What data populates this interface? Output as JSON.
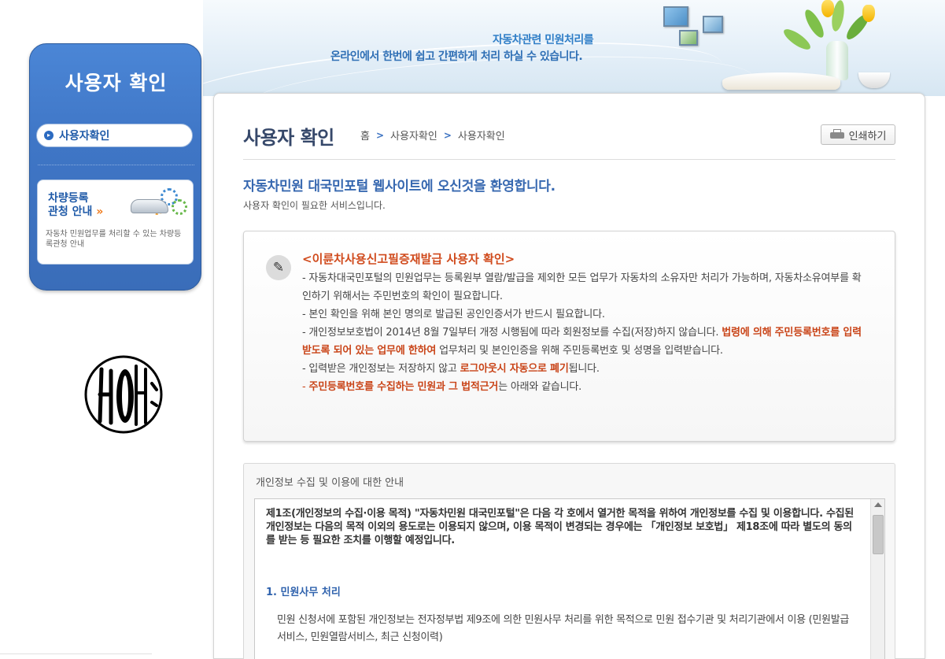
{
  "banner": {
    "line1": "자동차관련 민원처리를",
    "line2": "온라인에서 한번에 쉽고 간편하게 처리 하실 수 있습니다."
  },
  "sidebar": {
    "title": "사용자 확인",
    "items": [
      {
        "label": "사용자확인",
        "icon": "circle-arrow-icon"
      }
    ],
    "promo": {
      "title_line1": "차량등록",
      "title_line2": "관청 안내",
      "arrow": "»",
      "description": "자동차 민원업무를 처리할 수 있는 차량등록관청 안내"
    }
  },
  "header": {
    "page_title": "사용자 확인",
    "breadcrumb": [
      "홈",
      "사용자확인",
      "사용자확인"
    ],
    "breadcrumb_separator": ">",
    "print_label": "인쇄하기"
  },
  "welcome": {
    "title": "자동차민원 대국민포털 웹사이트에 오신것을 환영합니다.",
    "subtitle": "사용자 확인이 필요한 서비스입니다."
  },
  "notice": {
    "heading": "<이륜차사용신고필증재발급 사용자 확인>",
    "p1": "- 자동차대국민포털의 민원업무는 등록원부 열람/발급을 제외한 모든 업무가 자동차의 소유자만 처리가 가능하며, 자동차소유여부를 확인하기 위해서는 주민번호의 확인이 필요합니다.",
    "p2": "- 본인 확인을 위해 본인 명의로 발급된 공인인증서가 반드시 필요합니다.",
    "p3_a": "- 개인정보보호법이 2014년 8월 7일부터 개정 시행됨에 따라 회원정보를 수집(저장)하지 않습니다. ",
    "p3_hl": "법령에 의해 주민등록번호를 입력받도록 되어 있는 업무에 한하여",
    "p3_b": " 업무처리 및 본인인증을 위해 주민등록번호 및 성명을 입력받습니다.",
    "p4_a": "- 입력받은 개인정보는 저장하지 않고 ",
    "p4_hl": "로그아웃시 자동으로 폐기",
    "p4_b": "됩니다.",
    "p5_dash": "- ",
    "p5_hl": "주민등록번호를 수집하는 민원과 그 법적근거",
    "p5_b": "는 아래와 같습니다."
  },
  "privacy": {
    "title": "개인정보 수집 및 이용에 대한 안내",
    "intro": "제1조(개인정보의 수집·이용 목적) \"자동차민원 대국민포털\"은 다음 각 호에서 열거한 목적을 위하여 개인정보를 수집 및 이용합니다. 수집된 개인정보는 다음의 목적 이외의 용도로는 이용되지 않으며, 이용 목적이 변경되는 경우에는 「개인정보 보호법」 제18조에 따라 별도의 동의를 받는 등 필요한 조치를 이행할 예정입니다.",
    "article1_title": "1. 민원사무 처리",
    "article1_body": "민원 신청서에 포함된 개인정보는 전자정부법 제9조에 의한 민원사무 처리를 위한 목적으로 민원 접수기관 및 처리기관에서 이용 (민원발급서비스, 민원열람서비스, 최근 신청이력)"
  },
  "colors": {
    "sidebar_blue": "#3f76c6",
    "title_navy": "#36486a",
    "accent_blue": "#3768b0",
    "highlight_orange": "#c94418"
  }
}
